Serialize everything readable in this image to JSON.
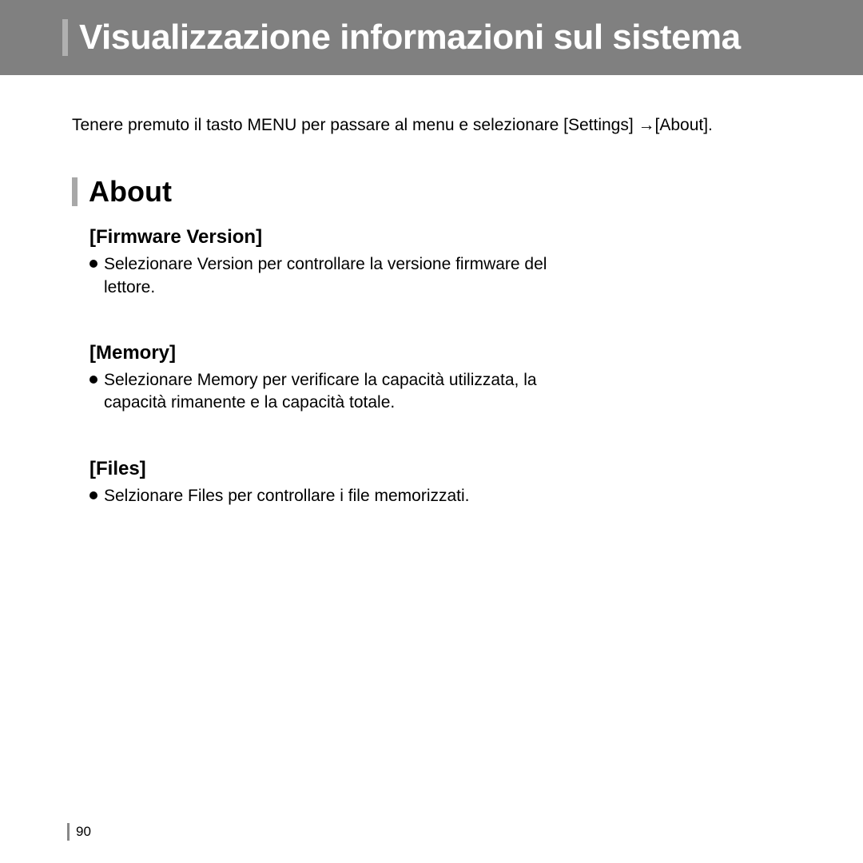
{
  "header": {
    "title": "Visualizzazione informazioni sul sistema"
  },
  "intro": "Tenere premuto il tasto MENU per passare al menu e selezionare [Settings] →[About].",
  "section": {
    "title": "About"
  },
  "subsections": [
    {
      "label": "[Firmware Version]",
      "bullet": "Selezionare Version per controllare la versione firmware del lettore."
    },
    {
      "label": "[Memory]",
      "bullet": "Selezionare Memory per verificare la capacità utilizzata, la capacità rimanente e la capacità totale."
    },
    {
      "label": "[Files]",
      "bullet": "Selzionare Files per controllare i file memorizzati."
    }
  ],
  "page_number": "90"
}
